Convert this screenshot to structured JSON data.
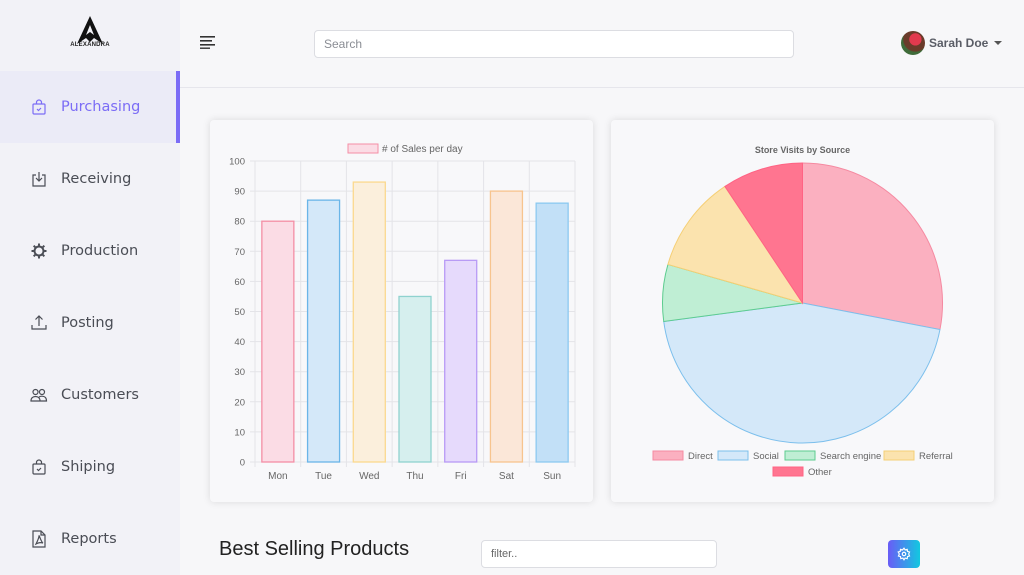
{
  "brand": {
    "name": "ALEXANDRA"
  },
  "sidebar": {
    "items": [
      {
        "label": "Purchasing",
        "icon": "shopping-bag-check-icon",
        "active": true
      },
      {
        "label": "Receiving",
        "icon": "download-tray-icon",
        "active": false
      },
      {
        "label": "Production",
        "icon": "gear-icon",
        "active": false
      },
      {
        "label": "Posting",
        "icon": "upload-icon",
        "active": false
      },
      {
        "label": "Customers",
        "icon": "users-icon",
        "active": false
      },
      {
        "label": "Shiping",
        "icon": "shopping-bag-check-icon",
        "active": false
      },
      {
        "label": "Reports",
        "icon": "pdf-file-icon",
        "active": false
      }
    ],
    "accent": "#7b6cf6"
  },
  "header": {
    "menu_icon": "hamburger-icon",
    "search": {
      "placeholder": "Search",
      "value": ""
    },
    "user": {
      "name": "Sarah Doe"
    }
  },
  "section": {
    "title": "Best Selling Products",
    "filter": {
      "placeholder": "filter..",
      "value": ""
    },
    "settings_icon": "gear-icon"
  },
  "chart_data": [
    {
      "type": "bar",
      "title": "",
      "legend": [
        "# of Sales per day"
      ],
      "legend_position": "top",
      "categories": [
        "Mon",
        "Tue",
        "Wed",
        "Thu",
        "Fri",
        "Sat",
        "Sun"
      ],
      "series": [
        {
          "name": "# of Sales per day",
          "values": [
            80,
            87,
            93,
            55,
            67,
            90,
            86
          ]
        }
      ],
      "ylim": [
        0,
        100
      ],
      "yticks": [
        0,
        10,
        20,
        30,
        40,
        50,
        60,
        70,
        80,
        90,
        100
      ],
      "grid": true,
      "fills": [
        "#fbdce5",
        "#d4e8f9",
        "#fbefdc",
        "#d6efee",
        "#e6dafc",
        "#fbe7d8",
        "#c2e0f7"
      ],
      "strokes": [
        "#f48ea5",
        "#6ab5e8",
        "#fbd98e",
        "#8fd2cf",
        "#b89af5",
        "#f7c48e",
        "#8cc9f0"
      ],
      "xlabel": "",
      "ylabel": ""
    },
    {
      "type": "pie",
      "title": "Store Visits by Source",
      "labels": [
        "Direct",
        "Social",
        "Search engine",
        "Referral",
        "Other"
      ],
      "values": [
        30,
        48,
        7,
        12,
        10
      ],
      "fills": [
        "#fbb0c0",
        "#d4e8f9",
        "#bfeed4",
        "#fbe3ae",
        "#ff7590"
      ],
      "strokes": [
        "#f58aa1",
        "#7cbfec",
        "#5dcc8f",
        "#f5cf75",
        "#ff6384"
      ],
      "legend_position": "bottom"
    }
  ]
}
